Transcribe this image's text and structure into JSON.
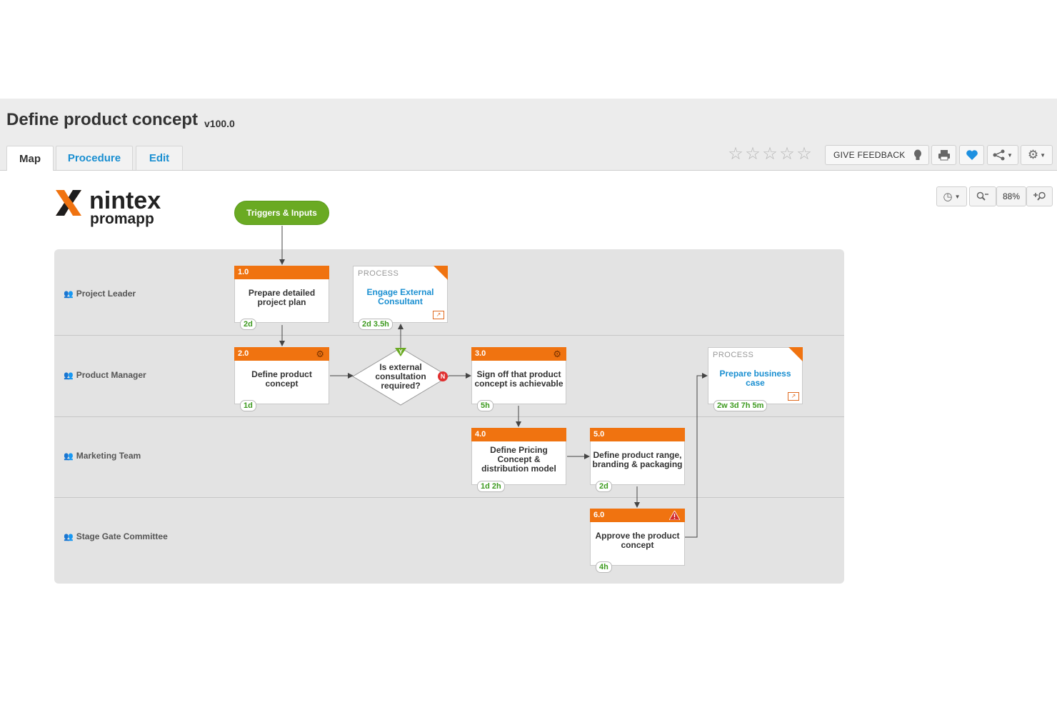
{
  "page": {
    "title": "Define product concept",
    "version": "v100.0"
  },
  "tabs": [
    {
      "label": "Map",
      "active": true
    },
    {
      "label": "Procedure"
    },
    {
      "label": "Edit"
    }
  ],
  "toolbar": {
    "rating": {
      "value": 0,
      "max": 5
    },
    "give_feedback_label": "GIVE FEEDBACK",
    "zoom_level": "88%"
  },
  "logo": {
    "line1": "nintex",
    "line2": "promapp"
  },
  "colors": {
    "activity_header": "#f07310",
    "trigger": "#6aaa23",
    "link": "#1a8fd1",
    "duration": "#3d9a1f",
    "favorite": "#1e90e0"
  },
  "trigger": {
    "label": "Triggers & Inputs"
  },
  "lanes": [
    {
      "label": "Project Leader"
    },
    {
      "label": "Product Manager"
    },
    {
      "label": "Marketing Team"
    },
    {
      "label": "Stage Gate Committee"
    }
  ],
  "activities": [
    {
      "number": "1.0",
      "text": "Prepare detailed project plan",
      "duration": "2d",
      "icon": ""
    },
    {
      "number": "2.0",
      "text": "Define product concept",
      "duration": "1d",
      "icon": "gear-icon"
    },
    {
      "number": "3.0",
      "text": "Sign off that product concept is achievable",
      "duration": "5h",
      "icon": "gear-icon"
    },
    {
      "number": "4.0",
      "text": "Define Pricing Concept & distribution model",
      "duration": "1d 2h",
      "icon": ""
    },
    {
      "number": "5.0",
      "text": "Define product range, branding & packaging",
      "duration": "2d",
      "icon": ""
    },
    {
      "number": "6.0",
      "text": "Approve the product concept",
      "duration": "4h",
      "icon": "warning-icon"
    }
  ],
  "processes": [
    {
      "label": "PROCESS",
      "text": "Engage External Consultant",
      "duration": "2d 3.5h"
    },
    {
      "label": "PROCESS",
      "text": "Prepare business case",
      "duration": "2w 3d 7h 5m"
    }
  ],
  "decision": {
    "text": "Is external consultation required?",
    "yes": "Y",
    "no": "N"
  }
}
